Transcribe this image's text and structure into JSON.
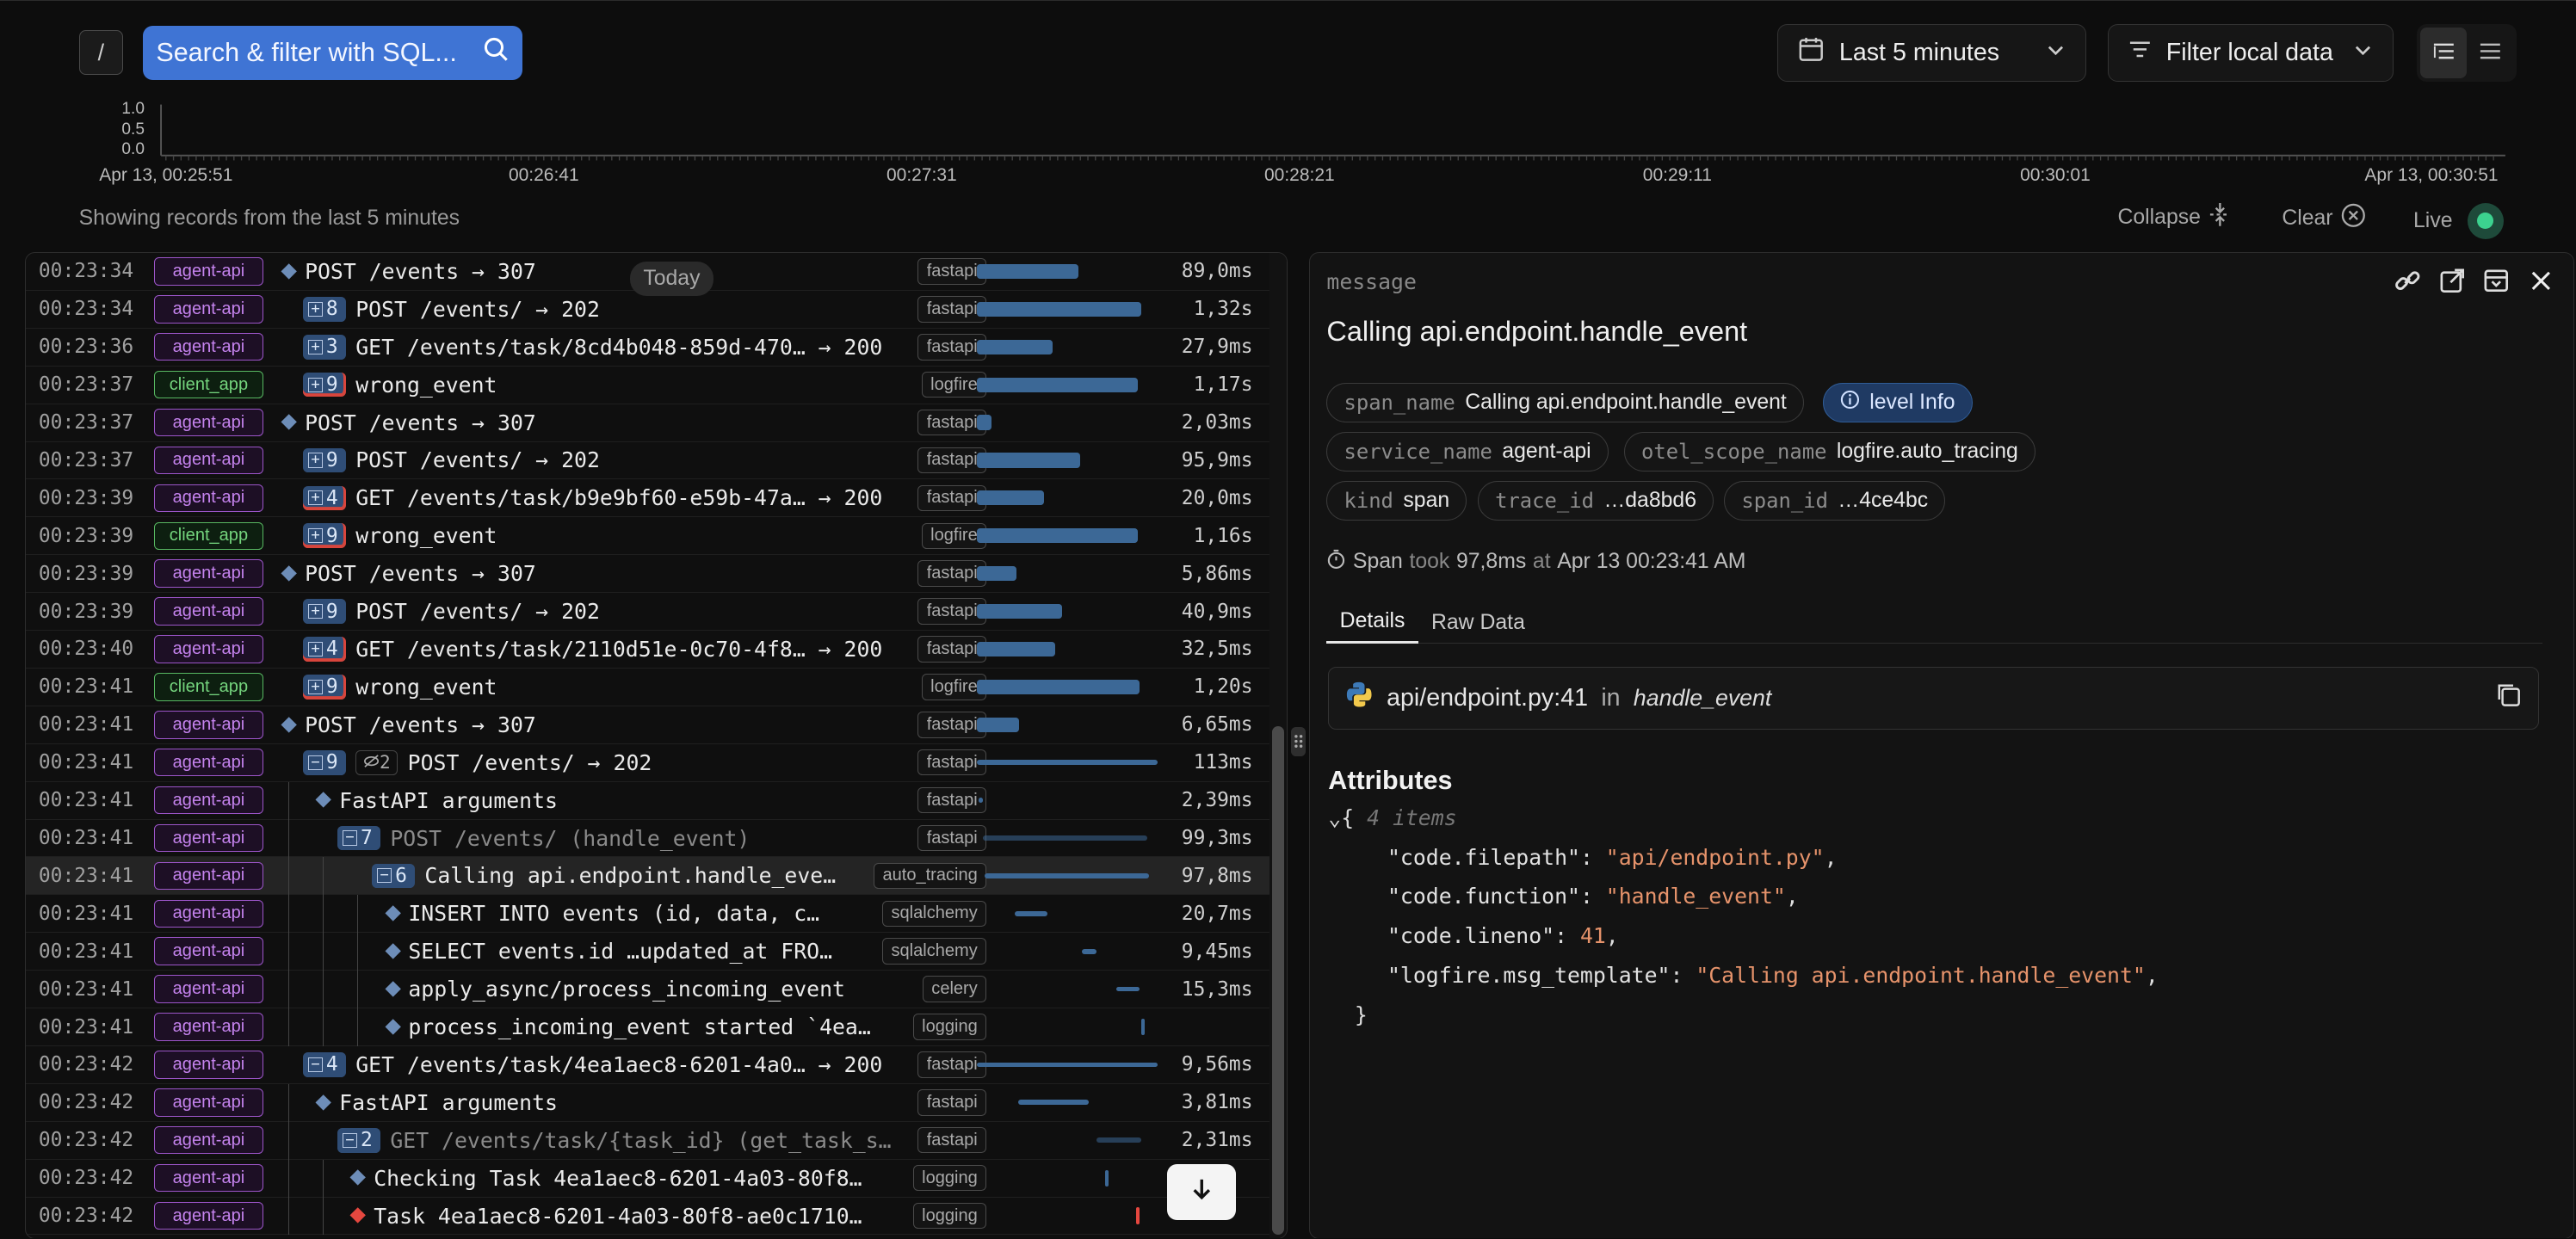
{
  "toolbar": {
    "slash_label": "/",
    "search_placeholder": "Search & filter with SQL...",
    "time_range": "Last 5 minutes",
    "filter_label": "Filter local data"
  },
  "histogram": {
    "y_ticks": [
      "1.0",
      "0.5",
      "0.0"
    ],
    "x_ticks": [
      "Apr 13, 00:25:51",
      "00:26:41",
      "00:27:31",
      "00:28:21",
      "00:29:11",
      "00:30:01",
      "Apr 13, 00:30:51"
    ]
  },
  "records_note": "Showing records from the last 5 minutes",
  "controls": {
    "collapse": "Collapse",
    "clear": "Clear",
    "live": "Live"
  },
  "today_pill": "Today",
  "rows": [
    {
      "ts": "00:23:34",
      "svc": "agent-api",
      "kind": "api",
      "marker": "diamond",
      "count": "",
      "msg": "POST /events → 307",
      "scope": "fastapi",
      "dur": "89,0ms",
      "indent": 0,
      "bar": [
        0,
        62
      ]
    },
    {
      "ts": "00:23:34",
      "svc": "agent-api",
      "kind": "api",
      "marker": "count",
      "count": "8",
      "msg": "POST /events/ → 202",
      "scope": "fastapi",
      "dur": "1,32s",
      "indent": 0,
      "bar": [
        0,
        100
      ]
    },
    {
      "ts": "00:23:36",
      "svc": "agent-api",
      "kind": "api",
      "marker": "count",
      "count": "3",
      "msg": "GET /events/task/8cd4b048-859d-470…  → 200",
      "scope": "fastapi",
      "dur": "27,9ms",
      "indent": 0,
      "bar": [
        0,
        46
      ]
    },
    {
      "ts": "00:23:37",
      "svc": "client_app",
      "kind": "client",
      "marker": "count-err",
      "count": "9",
      "msg": "wrong_event",
      "scope": "logfire",
      "dur": "1,17s",
      "indent": 0,
      "bar": [
        0,
        98
      ]
    },
    {
      "ts": "00:23:37",
      "svc": "agent-api",
      "kind": "api",
      "marker": "diamond",
      "count": "",
      "msg": "POST /events → 307",
      "scope": "fastapi",
      "dur": "2,03ms",
      "indent": 0,
      "bar": [
        0,
        9
      ]
    },
    {
      "ts": "00:23:37",
      "svc": "agent-api",
      "kind": "api",
      "marker": "count",
      "count": "9",
      "msg": "POST /events/ → 202",
      "scope": "fastapi",
      "dur": "95,9ms",
      "indent": 0,
      "bar": [
        0,
        63
      ]
    },
    {
      "ts": "00:23:39",
      "svc": "agent-api",
      "kind": "api",
      "marker": "count-err",
      "count": "4",
      "msg": "GET /events/task/b9e9bf60-e59b-47a…  → 200",
      "scope": "fastapi",
      "dur": "20,0ms",
      "indent": 0,
      "bar": [
        0,
        41
      ]
    },
    {
      "ts": "00:23:39",
      "svc": "client_app",
      "kind": "client",
      "marker": "count-err",
      "count": "9",
      "msg": "wrong_event",
      "scope": "logfire",
      "dur": "1,16s",
      "indent": 0,
      "bar": [
        0,
        98
      ]
    },
    {
      "ts": "00:23:39",
      "svc": "agent-api",
      "kind": "api",
      "marker": "diamond",
      "count": "",
      "msg": "POST /events → 307",
      "scope": "fastapi",
      "dur": "5,86ms",
      "indent": 0,
      "bar": [
        0,
        24
      ]
    },
    {
      "ts": "00:23:39",
      "svc": "agent-api",
      "kind": "api",
      "marker": "count",
      "count": "9",
      "msg": "POST /events/ → 202",
      "scope": "fastapi",
      "dur": "40,9ms",
      "indent": 0,
      "bar": [
        0,
        52
      ]
    },
    {
      "ts": "00:23:40",
      "svc": "agent-api",
      "kind": "api",
      "marker": "count-err",
      "count": "4",
      "msg": "GET /events/task/2110d51e-0c70-4f8…  → 200",
      "scope": "fastapi",
      "dur": "32,5ms",
      "indent": 0,
      "bar": [
        0,
        48
      ]
    },
    {
      "ts": "00:23:41",
      "svc": "client_app",
      "kind": "client",
      "marker": "count-err",
      "count": "9",
      "msg": "wrong_event",
      "scope": "logfire",
      "dur": "1,20s",
      "indent": 0,
      "bar": [
        0,
        99
      ]
    },
    {
      "ts": "00:23:41",
      "svc": "agent-api",
      "kind": "api",
      "marker": "diamond",
      "count": "",
      "msg": "POST /events → 307",
      "scope": "fastapi",
      "dur": "6,65ms",
      "indent": 0,
      "bar": [
        0,
        26
      ]
    },
    {
      "ts": "00:23:41",
      "svc": "agent-api",
      "kind": "api",
      "marker": "expanded",
      "count": "9",
      "hidden": "2",
      "msg": "POST /events/ → 202",
      "scope": "fastapi",
      "dur": "113ms",
      "indent": 0,
      "bar": [
        0,
        110
      ],
      "thin": true
    },
    {
      "ts": "00:23:41",
      "svc": "agent-api",
      "kind": "api",
      "marker": "diamond",
      "count": "",
      "msg": "FastAPI arguments",
      "scope": "fastapi",
      "dur": "2,39ms",
      "indent": 1,
      "bar": [
        1,
        3
      ],
      "thin": true
    },
    {
      "ts": "00:23:41",
      "svc": "agent-api",
      "kind": "api",
      "marker": "expanded",
      "count": "7",
      "msg": "POST /events/ (handle_event)",
      "scope": "fastapi",
      "dur": "99,3ms",
      "indent": 1,
      "bar": [
        4,
        100
      ],
      "thin": true,
      "dim": true
    },
    {
      "ts": "00:23:41",
      "svc": "agent-api",
      "kind": "api",
      "marker": "expanded",
      "count": "6",
      "msg": "Calling api.endpoint.handle_eve…",
      "scope": "auto_tracing",
      "dur": "97,8ms",
      "indent": 2,
      "bar": [
        5,
        100
      ],
      "thin": true,
      "hl": true
    },
    {
      "ts": "00:23:41",
      "svc": "agent-api",
      "kind": "api",
      "marker": "diamond",
      "count": "",
      "msg": "INSERT INTO events (id, data, c…",
      "scope": "sqlalchemy",
      "dur": "20,7ms",
      "indent": 3,
      "bar": [
        23,
        20
      ],
      "thin": true
    },
    {
      "ts": "00:23:41",
      "svc": "agent-api",
      "kind": "api",
      "marker": "diamond",
      "count": "",
      "msg": "SELECT events.id …updated_at FRO…",
      "scope": "sqlalchemy",
      "dur": "9,45ms",
      "indent": 3,
      "bar": [
        64,
        9
      ],
      "thin": true
    },
    {
      "ts": "00:23:41",
      "svc": "agent-api",
      "kind": "api",
      "marker": "diamond",
      "count": "",
      "msg": "apply_async/process_incoming_event",
      "scope": "celery",
      "dur": "15,3ms",
      "indent": 3,
      "bar": [
        85,
        14
      ],
      "thin": true
    },
    {
      "ts": "00:23:41",
      "svc": "agent-api",
      "kind": "api",
      "marker": "diamond",
      "count": "",
      "msg": "process_incoming_event started `4ea…",
      "scope": "logging",
      "dur": "",
      "indent": 3,
      "bar": [
        100,
        1
      ],
      "thin": true
    },
    {
      "ts": "00:23:42",
      "svc": "agent-api",
      "kind": "api",
      "marker": "expanded",
      "count": "4",
      "msg": "GET /events/task/4ea1aec8-6201-4a0…  → 200",
      "scope": "fastapi",
      "dur": "9,56ms",
      "indent": 0,
      "bar": [
        0,
        110
      ],
      "thin": true
    },
    {
      "ts": "00:23:42",
      "svc": "agent-api",
      "kind": "api",
      "marker": "diamond",
      "count": "",
      "msg": "FastAPI arguments",
      "scope": "fastapi",
      "dur": "3,81ms",
      "indent": 1,
      "bar": [
        25,
        43
      ],
      "thin": true
    },
    {
      "ts": "00:23:42",
      "svc": "agent-api",
      "kind": "api",
      "marker": "expanded",
      "count": "2",
      "msg": "GET /events/task/{task_id} (get_task_s…",
      "scope": "fastapi",
      "dur": "2,31ms",
      "indent": 1,
      "bar": [
        73,
        27
      ],
      "thin": true,
      "dim": true
    },
    {
      "ts": "00:23:42",
      "svc": "agent-api",
      "kind": "api",
      "marker": "diamond",
      "count": "",
      "msg": "Checking Task 4ea1aec8-6201-4a03-80f8…",
      "scope": "logging",
      "dur": "",
      "indent": 2,
      "bar": [
        78,
        1
      ],
      "thin": true
    },
    {
      "ts": "00:23:42",
      "svc": "agent-api",
      "kind": "api",
      "marker": "diamond-red",
      "count": "",
      "msg": "Task 4ea1aec8-6201-4a03-80f8-ae0c1710…",
      "scope": "logging",
      "dur": "",
      "indent": 2,
      "bar": [
        97,
        1
      ],
      "thin": true,
      "red": true
    }
  ],
  "detail": {
    "label": "message",
    "title": "Calling api.endpoint.handle_event",
    "chips": [
      {
        "k": "span_name",
        "v": "Calling api.endpoint.handle_event"
      },
      {
        "k": "",
        "v": "level Info",
        "level": true
      },
      {
        "k": "service_name",
        "v": "agent-api"
      },
      {
        "k": "otel_scope_name",
        "v": "logfire.auto_tracing"
      },
      {
        "k": "kind",
        "v": "span"
      },
      {
        "k": "trace_id",
        "v": "…da8bd6"
      },
      {
        "k": "span_id",
        "v": "…4ce4bc"
      }
    ],
    "took": {
      "a": "Span",
      "b": "took",
      "c": "97,8ms",
      "d": "at",
      "e": "Apr 13 00:23:41 AM"
    },
    "tabs": [
      "Details",
      "Raw Data"
    ],
    "code_file": "api/endpoint.py:41",
    "code_in": "in",
    "code_fn": "handle_event",
    "attributes_title": "Attributes",
    "json_meta": "4 items",
    "attributes": [
      {
        "k": "\"code.filepath\"",
        "v": "\"api/endpoint.py\""
      },
      {
        "k": "\"code.function\"",
        "v": "\"handle_event\""
      },
      {
        "k": "\"code.lineno\"",
        "v": "41"
      },
      {
        "k": "\"logfire.msg_template\"",
        "v": "\"Calling api.endpoint.handle_event\""
      }
    ]
  },
  "colors": {
    "accent": "#3f74d4",
    "bar": "#3c6896",
    "service_api": "#c583ee",
    "service_client": "#74d47d",
    "error": "#e5473f"
  }
}
